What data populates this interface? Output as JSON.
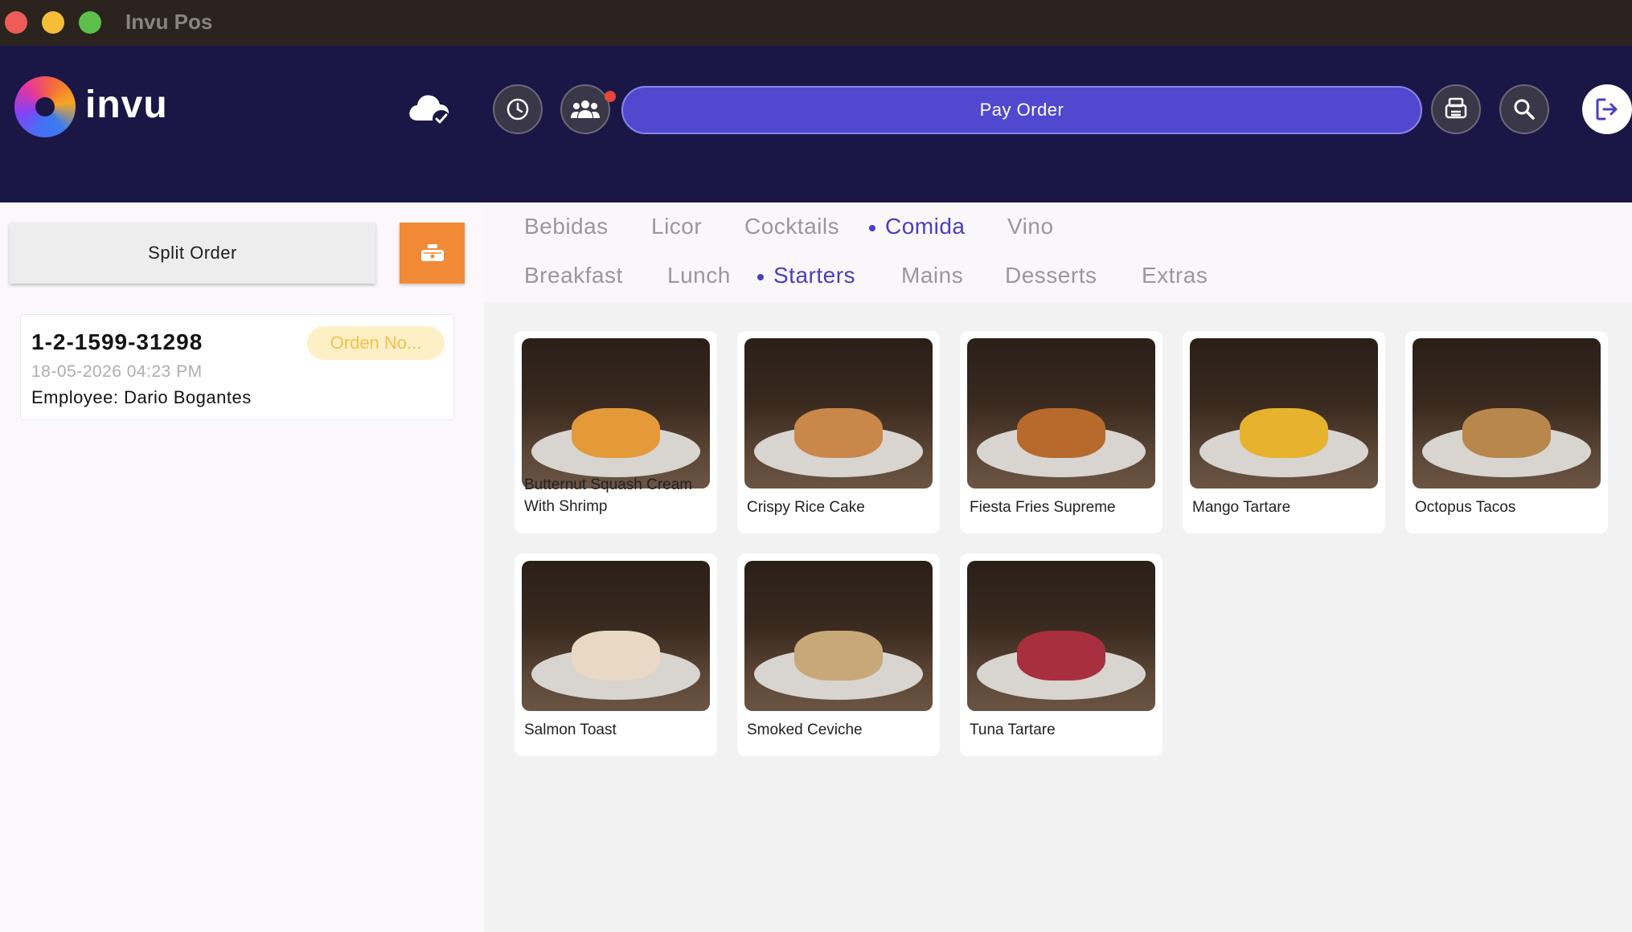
{
  "window": {
    "title": "Invu Pos"
  },
  "header": {
    "logo_text": "invu",
    "pay_order_label": "Pay Order"
  },
  "left": {
    "split_order_label": "Split Order",
    "order": {
      "number": "1-2-1599-31298",
      "badge": "Orden No...",
      "datetime": "18-05-2026 04:23 PM",
      "employee_label": "Employee:",
      "employee_name": "Dario Bogantes"
    }
  },
  "categories": {
    "main": [
      "Bebidas",
      "Licor",
      "Cocktails",
      "Comida",
      "Vino"
    ],
    "main_active": "Comida",
    "sub": [
      "Breakfast",
      "Lunch",
      "Starters",
      "Mains",
      "Desserts",
      "Extras"
    ],
    "sub_active": "Starters"
  },
  "products": [
    {
      "name": "Butternut Squash Cream With Shrimp",
      "food_color": "#e59a3a"
    },
    {
      "name": "Crispy Rice Cake",
      "food_color": "#c9874a"
    },
    {
      "name": "Fiesta Fries Supreme",
      "food_color": "#b76a2c"
    },
    {
      "name": "Mango Tartare",
      "food_color": "#e7b22d"
    },
    {
      "name": "Octopus Tacos",
      "food_color": "#b9874b"
    },
    {
      "name": "Salmon Toast",
      "food_color": "#e8d8c4"
    },
    {
      "name": "Smoked Ceviche",
      "food_color": "#c8a878"
    },
    {
      "name": "Tuna Tartare",
      "food_color": "#a8303e"
    }
  ],
  "icons": {
    "cloud": "cloud-check-icon",
    "history": "clock-icon",
    "customers": "users-icon",
    "print": "printer-icon",
    "search": "search-icon",
    "logout": "logout-icon",
    "orange_button": "cash-drawer-icon"
  },
  "colors": {
    "accent": "#5049cf",
    "header_bg": "#1a1746",
    "orange": "#f08a36",
    "active_tab": "#4b3fbd"
  }
}
